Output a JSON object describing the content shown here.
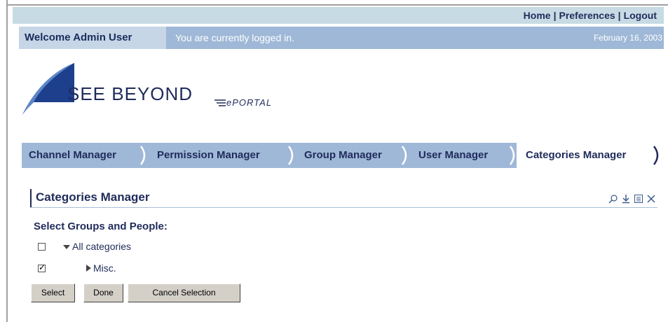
{
  "top_links": [
    "Home",
    "Preferences",
    "Logout"
  ],
  "welcome": {
    "user_label": "Welcome Admin User",
    "status": "You are currently logged in.",
    "date": "February 16, 2003"
  },
  "logo": {
    "brand": "SEE BEYOND",
    "product": "ePORTAL"
  },
  "tabs": [
    {
      "label": "Channel Manager",
      "active": false
    },
    {
      "label": "Permission Manager",
      "active": false
    },
    {
      "label": "Group Manager",
      "active": false
    },
    {
      "label": "User Manager",
      "active": false
    },
    {
      "label": "Categories Manager",
      "active": true
    }
  ],
  "panel": {
    "title": "Categories Manager",
    "icons": [
      "search-icon",
      "download-icon",
      "edit-icon",
      "close-icon"
    ]
  },
  "section_label": "Select Groups and People:",
  "tree": [
    {
      "label": "All categories",
      "checked": false,
      "expanded": true
    },
    {
      "label": "Misc.",
      "checked": true,
      "expanded": false
    }
  ],
  "buttons": {
    "select": "Select",
    "done": "Done",
    "cancel": "Cancel Selection"
  },
  "colors": {
    "nav_blue": "#9fb8d7",
    "light_blue": "#c7dbe4",
    "text_dark": "#1f2b5a"
  }
}
